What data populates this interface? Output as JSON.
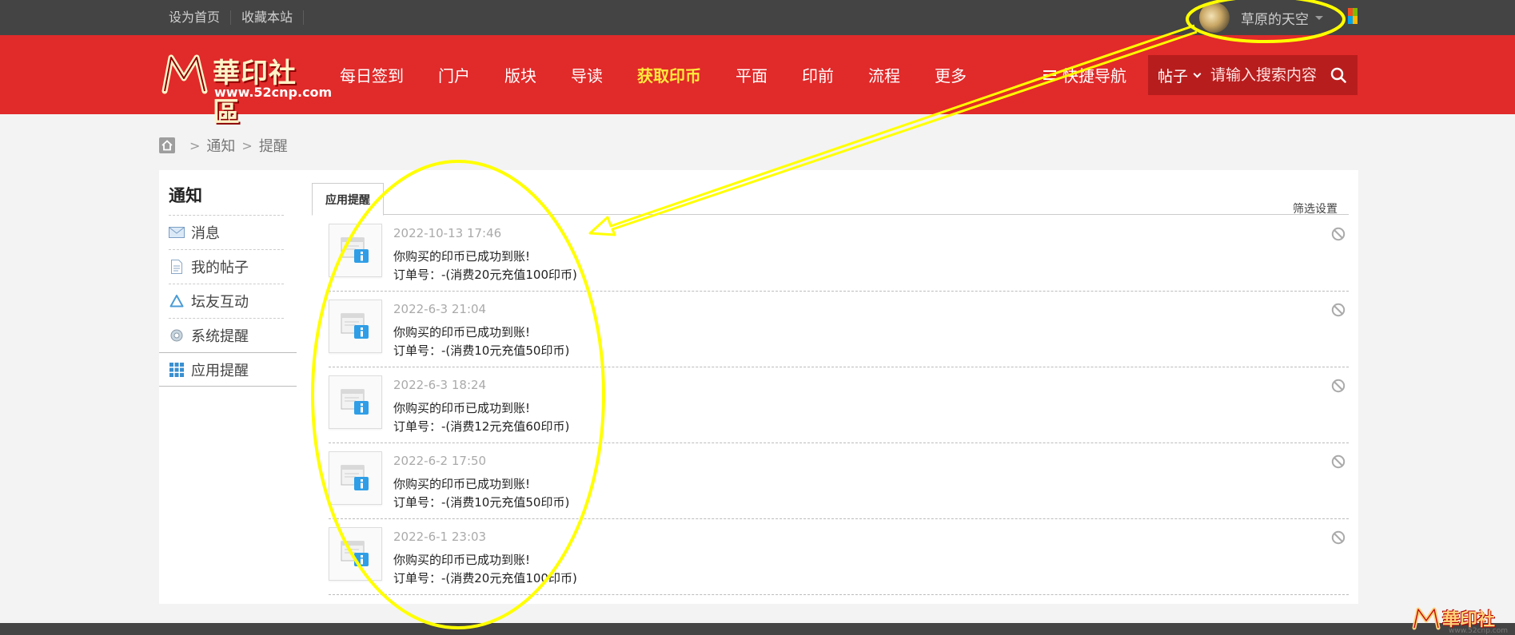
{
  "topbar": {
    "links": [
      "设为首页",
      "收藏本站"
    ],
    "username": "草原的天空"
  },
  "header": {
    "logo_name": "華印社區",
    "logo_url": "www.52cnp.com",
    "nav": [
      "每日签到",
      "门户",
      "版块",
      "导读",
      "获取印币",
      "平面",
      "印前",
      "流程",
      "更多"
    ],
    "nav_highlight_index": 4,
    "quick_nav": "快捷导航",
    "search_type": "帖子",
    "search_placeholder": "请输入搜索内容"
  },
  "breadcrumb": [
    "通知",
    "提醒"
  ],
  "sidebar": {
    "title": "通知",
    "items": [
      {
        "label": "消息",
        "icon": "mail-icon"
      },
      {
        "label": "我的帖子",
        "icon": "document-icon"
      },
      {
        "label": "坛友互动",
        "icon": "recycle-icon"
      },
      {
        "label": "系统提醒",
        "icon": "gear-icon"
      },
      {
        "label": "应用提醒",
        "icon": "grid-icon"
      }
    ],
    "active_index": 4
  },
  "main": {
    "tab": "应用提醒",
    "filter": "筛选设置",
    "notifications": [
      {
        "time": "2022-10-13 17:46",
        "line1": "你购买的印币已成功到账!",
        "line2": "订单号：-(消费20元充值100印币)"
      },
      {
        "time": "2022-6-3 21:04",
        "line1": "你购买的印币已成功到账!",
        "line2": "订单号：-(消费10元充值50印币)"
      },
      {
        "time": "2022-6-3 18:24",
        "line1": "你购买的印币已成功到账!",
        "line2": "订单号：-(消费12元充值60印币)"
      },
      {
        "time": "2022-6-2 17:50",
        "line1": "你购买的印币已成功到账!",
        "line2": "订单号：-(消费10元充值50印币)"
      },
      {
        "time": "2022-6-1 23:03",
        "line1": "你购买的印币已成功到账!",
        "line2": "订单号：-(消费20元充值100印币)"
      }
    ]
  },
  "watermark": {
    "name": "華印社區",
    "url": "www.52cnp.com"
  },
  "annotation_color": "#ffff00"
}
